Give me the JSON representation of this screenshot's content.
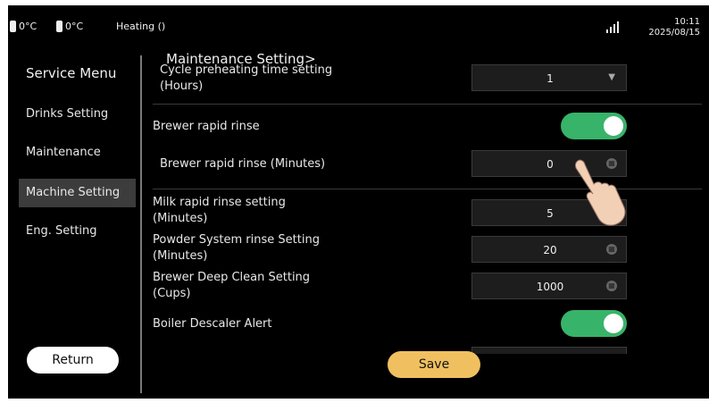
{
  "status_bar": {
    "temp1": "0°C",
    "temp2": "0°C",
    "heating": "Heating ()",
    "time": "10:11",
    "date": "2025/08/15"
  },
  "sidebar": {
    "title": "Service Menu",
    "items": [
      {
        "label": "Drinks Setting"
      },
      {
        "label": "Maintenance"
      },
      {
        "label": "Machine Setting",
        "active": true
      },
      {
        "label": "Eng. Setting"
      }
    ],
    "return_label": "Return"
  },
  "main": {
    "title": "Maintenance Setting>",
    "rows": [
      {
        "label_line1": "Cycle preheating time setting",
        "label_line2": "(Hours)",
        "type": "dropdown",
        "value": "1"
      },
      {
        "label": "Brewer rapid rinse",
        "type": "toggle",
        "state": "on"
      },
      {
        "label": "Brewer rapid rinse (Minutes)",
        "type": "number",
        "value": "0"
      },
      {
        "label_line1": "Milk rapid rinse setting",
        "label_line2": "(Minutes)",
        "type": "number",
        "value": "5"
      },
      {
        "label_line1": "Powder System rinse Setting",
        "label_line2": "(Minutes)",
        "type": "number",
        "value": "20"
      },
      {
        "label_line1": "Brewer Deep Clean Setting",
        "label_line2": "(Cups)",
        "type": "number",
        "value": "1000"
      },
      {
        "label": "Boiler Descaler Alert",
        "type": "toggle",
        "state": "on"
      }
    ],
    "save_label": "Save"
  },
  "colors": {
    "toggle_on": "#38b36a",
    "save_button": "#f0c060",
    "background": "#000000"
  }
}
